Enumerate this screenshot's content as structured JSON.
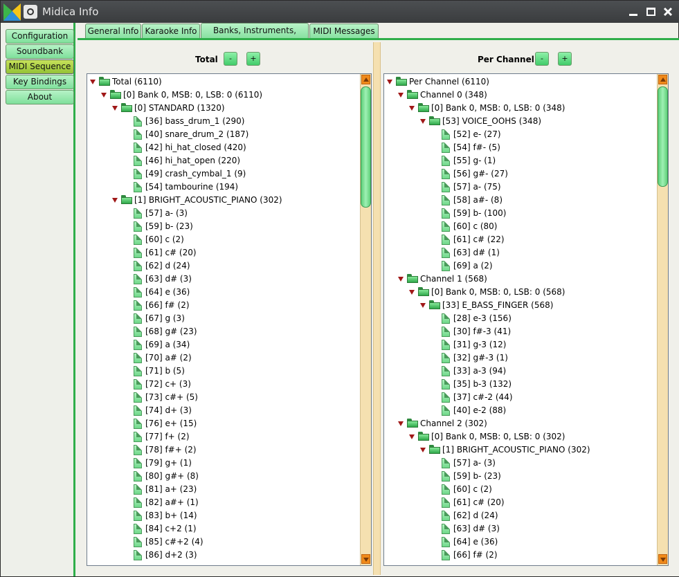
{
  "window": {
    "title": "Midica Info"
  },
  "sidebar": {
    "items": [
      {
        "label": "Configuration",
        "active": false
      },
      {
        "label": "Soundbank",
        "active": false
      },
      {
        "label": "MIDI Sequence",
        "active": true
      },
      {
        "label": "Key Bindings",
        "active": false
      },
      {
        "label": "About",
        "active": false
      }
    ]
  },
  "tabs": [
    {
      "label": "General Info",
      "active": false
    },
    {
      "label": "Karaoke Info",
      "active": false
    },
    {
      "label": "Banks, Instruments, Notes",
      "active": true
    },
    {
      "label": "MIDI Messages",
      "active": false
    }
  ],
  "panels": {
    "total": {
      "title": "Total",
      "minus": "-",
      "plus": "+",
      "rows": [
        {
          "level": 0,
          "type": "folder",
          "text": "Total (6110)"
        },
        {
          "level": 1,
          "type": "folder",
          "text": "[0] Bank 0, MSB: 0, LSB: 0 (6110)"
        },
        {
          "level": 2,
          "type": "folder",
          "text": "[0] STANDARD (1320)"
        },
        {
          "level": 3,
          "type": "leaf",
          "text": "[36] bass_drum_1 (290)"
        },
        {
          "level": 3,
          "type": "leaf",
          "text": "[40] snare_drum_2 (187)"
        },
        {
          "level": 3,
          "type": "leaf",
          "text": "[42] hi_hat_closed (420)"
        },
        {
          "level": 3,
          "type": "leaf",
          "text": "[46] hi_hat_open (220)"
        },
        {
          "level": 3,
          "type": "leaf",
          "text": "[49] crash_cymbal_1 (9)"
        },
        {
          "level": 3,
          "type": "leaf",
          "text": "[54] tambourine (194)"
        },
        {
          "level": 2,
          "type": "folder",
          "text": "[1] BRIGHT_ACOUSTIC_PIANO (302)"
        },
        {
          "level": 3,
          "type": "leaf",
          "text": "[57] a- (3)"
        },
        {
          "level": 3,
          "type": "leaf",
          "text": "[59] b- (23)"
        },
        {
          "level": 3,
          "type": "leaf",
          "text": "[60] c (2)"
        },
        {
          "level": 3,
          "type": "leaf",
          "text": "[61] c# (20)"
        },
        {
          "level": 3,
          "type": "leaf",
          "text": "[62] d (24)"
        },
        {
          "level": 3,
          "type": "leaf",
          "text": "[63] d# (3)"
        },
        {
          "level": 3,
          "type": "leaf",
          "text": "[64] e (36)"
        },
        {
          "level": 3,
          "type": "leaf",
          "text": "[66] f# (2)"
        },
        {
          "level": 3,
          "type": "leaf",
          "text": "[67] g (3)"
        },
        {
          "level": 3,
          "type": "leaf",
          "text": "[68] g# (23)"
        },
        {
          "level": 3,
          "type": "leaf",
          "text": "[69] a (34)"
        },
        {
          "level": 3,
          "type": "leaf",
          "text": "[70] a# (2)"
        },
        {
          "level": 3,
          "type": "leaf",
          "text": "[71] b (5)"
        },
        {
          "level": 3,
          "type": "leaf",
          "text": "[72] c+ (3)"
        },
        {
          "level": 3,
          "type": "leaf",
          "text": "[73] c#+ (5)"
        },
        {
          "level": 3,
          "type": "leaf",
          "text": "[74] d+ (3)"
        },
        {
          "level": 3,
          "type": "leaf",
          "text": "[76] e+ (15)"
        },
        {
          "level": 3,
          "type": "leaf",
          "text": "[77] f+ (2)"
        },
        {
          "level": 3,
          "type": "leaf",
          "text": "[78] f#+ (2)"
        },
        {
          "level": 3,
          "type": "leaf",
          "text": "[79] g+ (1)"
        },
        {
          "level": 3,
          "type": "leaf",
          "text": "[80] g#+ (8)"
        },
        {
          "level": 3,
          "type": "leaf",
          "text": "[81] a+ (23)"
        },
        {
          "level": 3,
          "type": "leaf",
          "text": "[82] a#+ (1)"
        },
        {
          "level": 3,
          "type": "leaf",
          "text": "[83] b+ (14)"
        },
        {
          "level": 3,
          "type": "leaf",
          "text": "[84] c+2 (1)"
        },
        {
          "level": 3,
          "type": "leaf",
          "text": "[85] c#+2 (4)"
        },
        {
          "level": 3,
          "type": "leaf",
          "text": "[86] d+2 (3)"
        }
      ]
    },
    "per_channel": {
      "title": "Per Channel",
      "minus": "-",
      "plus": "+",
      "rows": [
        {
          "level": 0,
          "type": "folder",
          "text": "Per Channel (6110)"
        },
        {
          "level": 1,
          "type": "folder",
          "text": "Channel 0 (348)"
        },
        {
          "level": 2,
          "type": "folder",
          "text": "[0] Bank 0, MSB: 0, LSB: 0 (348)"
        },
        {
          "level": 3,
          "type": "folder",
          "text": "[53] VOICE_OOHS (348)"
        },
        {
          "level": 4,
          "type": "leaf",
          "text": "[52] e- (27)"
        },
        {
          "level": 4,
          "type": "leaf",
          "text": "[54] f#- (5)"
        },
        {
          "level": 4,
          "type": "leaf",
          "text": "[55] g- (1)"
        },
        {
          "level": 4,
          "type": "leaf",
          "text": "[56] g#- (27)"
        },
        {
          "level": 4,
          "type": "leaf",
          "text": "[57] a- (75)"
        },
        {
          "level": 4,
          "type": "leaf",
          "text": "[58] a#- (8)"
        },
        {
          "level": 4,
          "type": "leaf",
          "text": "[59] b- (100)"
        },
        {
          "level": 4,
          "type": "leaf",
          "text": "[60] c (80)"
        },
        {
          "level": 4,
          "type": "leaf",
          "text": "[61] c# (22)"
        },
        {
          "level": 4,
          "type": "leaf",
          "text": "[63] d# (1)"
        },
        {
          "level": 4,
          "type": "leaf",
          "text": "[69] a (2)"
        },
        {
          "level": 1,
          "type": "folder",
          "text": "Channel 1 (568)"
        },
        {
          "level": 2,
          "type": "folder",
          "text": "[0] Bank 0, MSB: 0, LSB: 0 (568)"
        },
        {
          "level": 3,
          "type": "folder",
          "text": "[33] E_BASS_FINGER (568)"
        },
        {
          "level": 4,
          "type": "leaf",
          "text": "[28] e-3 (156)"
        },
        {
          "level": 4,
          "type": "leaf",
          "text": "[30] f#-3 (41)"
        },
        {
          "level": 4,
          "type": "leaf",
          "text": "[31] g-3 (12)"
        },
        {
          "level": 4,
          "type": "leaf",
          "text": "[32] g#-3 (1)"
        },
        {
          "level": 4,
          "type": "leaf",
          "text": "[33] a-3 (94)"
        },
        {
          "level": 4,
          "type": "leaf",
          "text": "[35] b-3 (132)"
        },
        {
          "level": 4,
          "type": "leaf",
          "text": "[37] c#-2 (44)"
        },
        {
          "level": 4,
          "type": "leaf",
          "text": "[40] e-2 (88)"
        },
        {
          "level": 1,
          "type": "folder",
          "text": "Channel 2 (302)"
        },
        {
          "level": 2,
          "type": "folder",
          "text": "[0] Bank 0, MSB: 0, LSB: 0 (302)"
        },
        {
          "level": 3,
          "type": "folder",
          "text": "[1] BRIGHT_ACOUSTIC_PIANO (302)"
        },
        {
          "level": 4,
          "type": "leaf",
          "text": "[57] a- (3)"
        },
        {
          "level": 4,
          "type": "leaf",
          "text": "[59] b- (23)"
        },
        {
          "level": 4,
          "type": "leaf",
          "text": "[60] c (2)"
        },
        {
          "level": 4,
          "type": "leaf",
          "text": "[61] c# (20)"
        },
        {
          "level": 4,
          "type": "leaf",
          "text": "[62] d (24)"
        },
        {
          "level": 4,
          "type": "leaf",
          "text": "[63] d# (3)"
        },
        {
          "level": 4,
          "type": "leaf",
          "text": "[64] e (36)"
        },
        {
          "level": 4,
          "type": "leaf",
          "text": "[66] f# (2)"
        }
      ]
    }
  }
}
